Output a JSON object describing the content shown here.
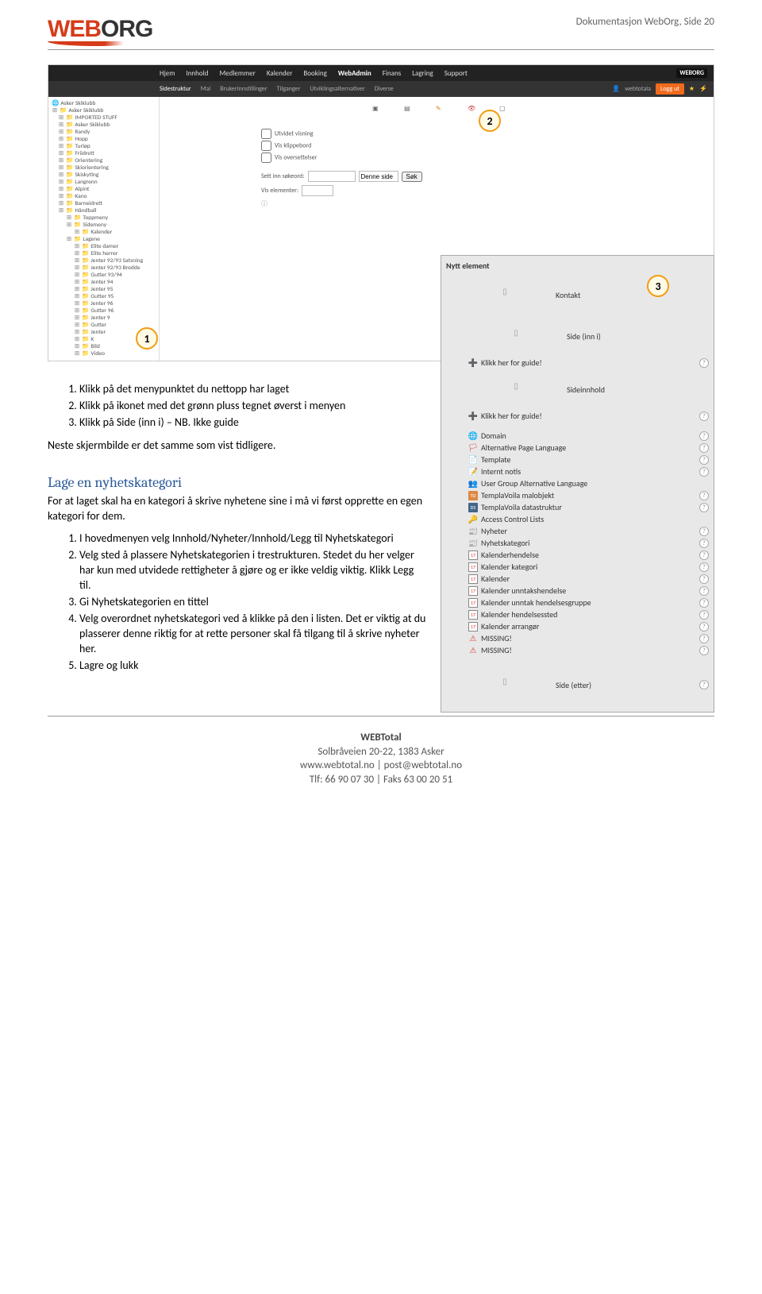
{
  "header": {
    "logo_web": "WEB",
    "logo_org": "ORG",
    "page_label": "Dokumentasjon WebOrg, Side 20"
  },
  "screenshot": {
    "topnav": [
      "Hjem",
      "Innhold",
      "Medlemmer",
      "Kalender",
      "Booking",
      "WebAdmin",
      "Finans",
      "Lagring",
      "Support"
    ],
    "topnav_logo": "WEBORG",
    "subnav": [
      "Sidestruktur",
      "Mal",
      "Brukerinnstillinger",
      "Tilganger",
      "Utviklingsalternativer",
      "Diverse"
    ],
    "subnav_user": "webtotala",
    "subnav_logout": "Logg ut",
    "tree": [
      {
        "t": "Asker Skiklubb",
        "lvl": 0,
        "i": "globe"
      },
      {
        "t": "Asker Skiklubb",
        "lvl": 0,
        "i": "fold"
      },
      {
        "t": "IMPORTED STUFF",
        "lvl": 1,
        "i": "fold"
      },
      {
        "t": "Asker Skiklubb",
        "lvl": 1,
        "i": "fold"
      },
      {
        "t": "Randy",
        "lvl": 1,
        "i": "fold"
      },
      {
        "t": "Hopp",
        "lvl": 1,
        "i": "fold"
      },
      {
        "t": "Turløp",
        "lvl": 1,
        "i": "fold"
      },
      {
        "t": "Friidrett",
        "lvl": 1,
        "i": "fold"
      },
      {
        "t": "Orientering",
        "lvl": 1,
        "i": "fold"
      },
      {
        "t": "Skiorientering",
        "lvl": 1,
        "i": "fold"
      },
      {
        "t": "Skiskyting",
        "lvl": 1,
        "i": "fold"
      },
      {
        "t": "Langrenn",
        "lvl": 1,
        "i": "fold"
      },
      {
        "t": "Alpint",
        "lvl": 1,
        "i": "fold"
      },
      {
        "t": "Kano",
        "lvl": 1,
        "i": "fold"
      },
      {
        "t": "Barneidrett",
        "lvl": 1,
        "i": "fold"
      },
      {
        "t": "Håndball",
        "lvl": 1,
        "i": "fold"
      },
      {
        "t": "Toppmeny",
        "lvl": 2,
        "i": "fold"
      },
      {
        "t": "Sidemeny",
        "lvl": 2,
        "i": "fold"
      },
      {
        "t": "Kalender",
        "lvl": 3,
        "i": "fold"
      },
      {
        "t": "Lagene",
        "lvl": 2,
        "i": "fold"
      },
      {
        "t": "Elite damer",
        "lvl": 3,
        "i": "fold"
      },
      {
        "t": "Elite herrer",
        "lvl": 3,
        "i": "fold"
      },
      {
        "t": "Jenter 92/93 Satsning",
        "lvl": 3,
        "i": "fold"
      },
      {
        "t": "Jenter 92/93 Bredde",
        "lvl": 3,
        "i": "fold"
      },
      {
        "t": "Gutter 93/94",
        "lvl": 3,
        "i": "fold"
      },
      {
        "t": "Jenter 94",
        "lvl": 3,
        "i": "fold"
      },
      {
        "t": "Jenter 95",
        "lvl": 3,
        "i": "fold"
      },
      {
        "t": "Gutter 95",
        "lvl": 3,
        "i": "fold"
      },
      {
        "t": "Jenter 96",
        "lvl": 3,
        "i": "fold"
      },
      {
        "t": "Gutter 96",
        "lvl": 3,
        "i": "fold"
      },
      {
        "t": "Jenter 9",
        "lvl": 3,
        "i": "fold"
      },
      {
        "t": "Gutter",
        "lvl": 3,
        "i": "fold"
      },
      {
        "t": "Jenter",
        "lvl": 3,
        "i": "fold"
      },
      {
        "t": "K",
        "lvl": 3,
        "i": "fold"
      },
      {
        "t": "Bild",
        "lvl": 3,
        "i": "fold"
      },
      {
        "t": "Video",
        "lvl": 3,
        "i": "fold"
      }
    ],
    "checks": [
      "Utvidet visning",
      "Vis klippebord",
      "Vis oversettelser"
    ],
    "search_label": "Sett inn søkeord:",
    "search_scope": "Denne side",
    "search_btn": "Søk",
    "vis_label": "Vis elementer:",
    "callout1": "1",
    "callout2": "2"
  },
  "instructions1": {
    "items": [
      "Klikk på det menypunktet du nettopp har laget",
      "Klikk på ikonet med det grønn pluss tegnet øverst i menyen",
      "Klikk på Side (inn i) – NB. Ikke guide"
    ],
    "note": "Neste skjermbilde er det samme som vist tidligere."
  },
  "section2": {
    "title": "Lage en nyhetskategori",
    "intro": "For at laget skal ha en kategori å skrive nyhetene sine i må vi først opprette en egen kategori for dem.",
    "items": [
      "I hovedmenyen velg Innhold/Nyheter/Innhold/Legg til Nyhetskategori",
      "Velg sted å plassere Nyhetskategorien i trestrukturen. Stedet du her velger har kun med utvidede rettigheter å gjøre og er ikke veldig viktig. Klikk Legg til.",
      "Gi Nyhetskategorien en tittel",
      "Velg overordnet nyhetskategori ved å klikke på den i listen. Det er viktig at du plasserer denne riktig for at rette personer skal få tilgang til å skrive nyheter her.",
      "Lagre og lukk"
    ]
  },
  "popup": {
    "title": "Nytt element",
    "row_kontakt": "Kontakt",
    "row_side": "Side (inn i)",
    "row_click1": "Klikk her for guide!",
    "row_sideinn": "Sideinnhold",
    "row_click2": "Klikk her for guide!",
    "items": [
      {
        "icon": "globe2",
        "label": "Domain",
        "q": true
      },
      {
        "icon": "flag",
        "label": "Alternative Page Language",
        "q": true
      },
      {
        "icon": "tpl",
        "label": "Template",
        "q": true
      },
      {
        "icon": "note2",
        "label": "Internt notis",
        "q": true
      },
      {
        "icon": "user",
        "label": "User Group Alternative Language",
        "q": false
      },
      {
        "icon": "to",
        "label": "TemplaVoila malobjekt",
        "q": true
      },
      {
        "icon": "ds",
        "label": "TemplaVoila datastruktur",
        "q": true
      },
      {
        "icon": "acl",
        "label": "Access Control Lists",
        "q": false
      },
      {
        "icon": "ny",
        "label": "Nyheter",
        "q": true
      },
      {
        "icon": "ny",
        "label": "Nyhetskategori",
        "q": true
      },
      {
        "icon": "k17",
        "label": "Kalenderhendelse",
        "q": true
      },
      {
        "icon": "k17",
        "label": "Kalender kategori",
        "q": true
      },
      {
        "icon": "k17",
        "label": "Kalender",
        "q": true
      },
      {
        "icon": "k17",
        "label": "Kalender unntakshendelse",
        "q": true
      },
      {
        "icon": "k17",
        "label": "Kalender unntak hendelsesgruppe",
        "q": true
      },
      {
        "icon": "k17",
        "label": "Kalender hendelsessted",
        "q": true
      },
      {
        "icon": "k17",
        "label": "Kalender arrangør",
        "q": true
      },
      {
        "icon": "warn",
        "label": "MISSING!",
        "q": true
      },
      {
        "icon": "warn",
        "label": "MISSING!",
        "q": true
      }
    ],
    "row_sideetter": "Side (etter)",
    "callout3": "3"
  },
  "footer": {
    "l1": "WEBTotal",
    "l2": "Solbråveien 20-22, 1383 Asker",
    "l3": "www.webtotal.no | post@webtotal.no",
    "l4": "Tlf: 66 90 07 30 | Faks 63 00 20 51"
  }
}
